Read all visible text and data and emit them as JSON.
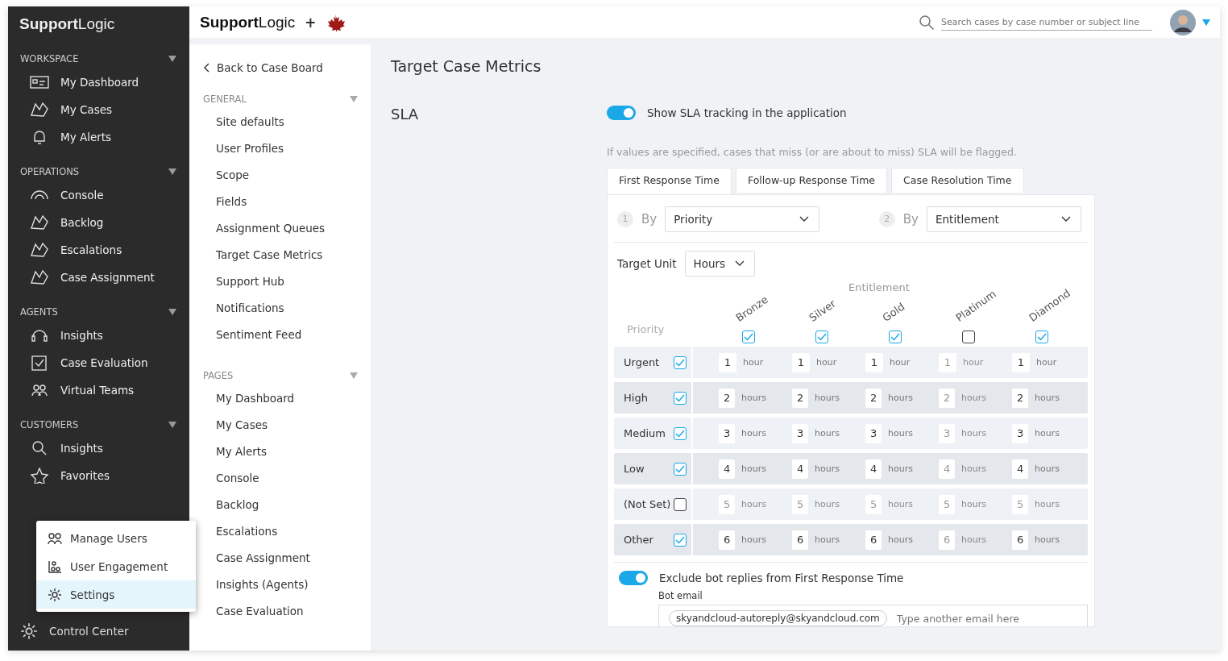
{
  "sidebar": {
    "logo": "**Support**Logic",
    "sections": [
      {
        "title": "WORKSPACE",
        "expanded": true,
        "items": [
          {
            "label": "My Dashboard"
          },
          {
            "label": "My Cases"
          },
          {
            "label": "My Alerts"
          }
        ]
      },
      {
        "title": "OPERATIONS",
        "expanded": true,
        "items": [
          {
            "label": "Console"
          },
          {
            "label": "Backlog"
          },
          {
            "label": "Escalations"
          },
          {
            "label": "Case Assignment"
          }
        ]
      },
      {
        "title": "AGENTS",
        "expanded": true,
        "items": [
          {
            "label": "Insights"
          },
          {
            "label": "Case Evaluation"
          },
          {
            "label": "Virtual Teams"
          }
        ]
      },
      {
        "title": "CUSTOMERS",
        "expanded": true,
        "items": [
          {
            "label": "Insights"
          },
          {
            "label": "Favorites"
          }
        ]
      }
    ],
    "control_center": "Control Center",
    "popup_menu": [
      {
        "label": "Manage Users",
        "selected": false
      },
      {
        "label": "User Engagement",
        "selected": false
      },
      {
        "label": "Settings",
        "selected": true
      }
    ]
  },
  "top_bar": {
    "logo": "**Support**Logic",
    "plus": "+",
    "search": {
      "placeholder": "Search cases by case number or subject line"
    }
  },
  "settings_nav": {
    "back": "Back to Case Board",
    "sections": [
      {
        "title": "GENERAL",
        "expanded": true,
        "items": [
          {
            "label": "Site defaults"
          },
          {
            "label": "User Profiles"
          },
          {
            "label": "Scope"
          },
          {
            "label": "Fields"
          },
          {
            "label": "Assignment Queues"
          },
          {
            "label": "Target Case Metrics"
          },
          {
            "label": "Support Hub"
          },
          {
            "label": "Notifications"
          },
          {
            "label": "Sentiment Feed"
          }
        ]
      },
      {
        "title": "PAGES",
        "expanded": true,
        "items": [
          {
            "label": "My Dashboard"
          },
          {
            "label": "My Cases"
          },
          {
            "label": "My Alerts"
          },
          {
            "label": "Console"
          },
          {
            "label": "Backlog"
          },
          {
            "label": "Escalations"
          },
          {
            "label": "Case Assignment"
          },
          {
            "label": "Insights (Agents)"
          },
          {
            "label": "Case Evaluation"
          }
        ]
      }
    ]
  },
  "page": {
    "title": "Target Case Metrics",
    "section": "SLA",
    "sla_toggle": {
      "label": "Show SLA tracking in the application",
      "on": true
    },
    "hint": "If values are specified, cases that miss (or are about to miss) SLA will be flagged.",
    "tabs": [
      {
        "label": "First Response Time",
        "selected": true
      },
      {
        "label": "Follow-up Response Time",
        "selected": false
      },
      {
        "label": "Case Resolution Time",
        "selected": false
      }
    ],
    "criteria": [
      {
        "number": "1",
        "by": "By",
        "value": "Priority"
      },
      {
        "number": "2",
        "by": "By",
        "value": "Entitlement"
      }
    ],
    "target_unit": {
      "label": "Target Unit",
      "value": "Hours"
    },
    "matrix": {
      "column_group": "Entitlement",
      "row_group": "Priority",
      "columns": [
        {
          "label": "Bronze",
          "checked": true
        },
        {
          "label": "Silver",
          "checked": true
        },
        {
          "label": "Gold",
          "checked": true
        },
        {
          "label": "Platinum",
          "checked": false
        },
        {
          "label": "Diamond",
          "checked": true
        }
      ],
      "rows": [
        {
          "label": "Urgent",
          "checked": true,
          "cells": [
            {
              "value": "1",
              "unit": "hour"
            },
            {
              "value": "1",
              "unit": "hour"
            },
            {
              "value": "1",
              "unit": "hour"
            },
            {
              "value": "1",
              "unit": "hour"
            },
            {
              "value": "1",
              "unit": "hour"
            }
          ]
        },
        {
          "label": "High",
          "checked": true,
          "cells": [
            {
              "value": "2",
              "unit": "hours"
            },
            {
              "value": "2",
              "unit": "hours"
            },
            {
              "value": "2",
              "unit": "hours"
            },
            {
              "value": "2",
              "unit": "hours"
            },
            {
              "value": "2",
              "unit": "hours"
            }
          ]
        },
        {
          "label": "Medium",
          "checked": true,
          "cells": [
            {
              "value": "3",
              "unit": "hours"
            },
            {
              "value": "3",
              "unit": "hours"
            },
            {
              "value": "3",
              "unit": "hours"
            },
            {
              "value": "3",
              "unit": "hours"
            },
            {
              "value": "3",
              "unit": "hours"
            }
          ]
        },
        {
          "label": "Low",
          "checked": true,
          "cells": [
            {
              "value": "4",
              "unit": "hours"
            },
            {
              "value": "4",
              "unit": "hours"
            },
            {
              "value": "4",
              "unit": "hours"
            },
            {
              "value": "4",
              "unit": "hours"
            },
            {
              "value": "4",
              "unit": "hours"
            }
          ]
        },
        {
          "label": "(Not Set)",
          "checked": false,
          "cells": [
            {
              "value": "5",
              "unit": "hours"
            },
            {
              "value": "5",
              "unit": "hours"
            },
            {
              "value": "5",
              "unit": "hours"
            },
            {
              "value": "5",
              "unit": "hours"
            },
            {
              "value": "5",
              "unit": "hours"
            }
          ]
        },
        {
          "label": "Other",
          "checked": true,
          "cells": [
            {
              "value": "6",
              "unit": "hours"
            },
            {
              "value": "6",
              "unit": "hours"
            },
            {
              "value": "6",
              "unit": "hours"
            },
            {
              "value": "6",
              "unit": "hours"
            },
            {
              "value": "6",
              "unit": "hours"
            }
          ]
        }
      ]
    },
    "bot_toggle": {
      "label": "Exclude bot replies from First Response Time",
      "on": true
    },
    "bot_email": {
      "label": "Bot email",
      "chips": [
        "skyandcloud-autoreply@skyandcloud.com"
      ],
      "placeholder": "Type another email here"
    }
  }
}
